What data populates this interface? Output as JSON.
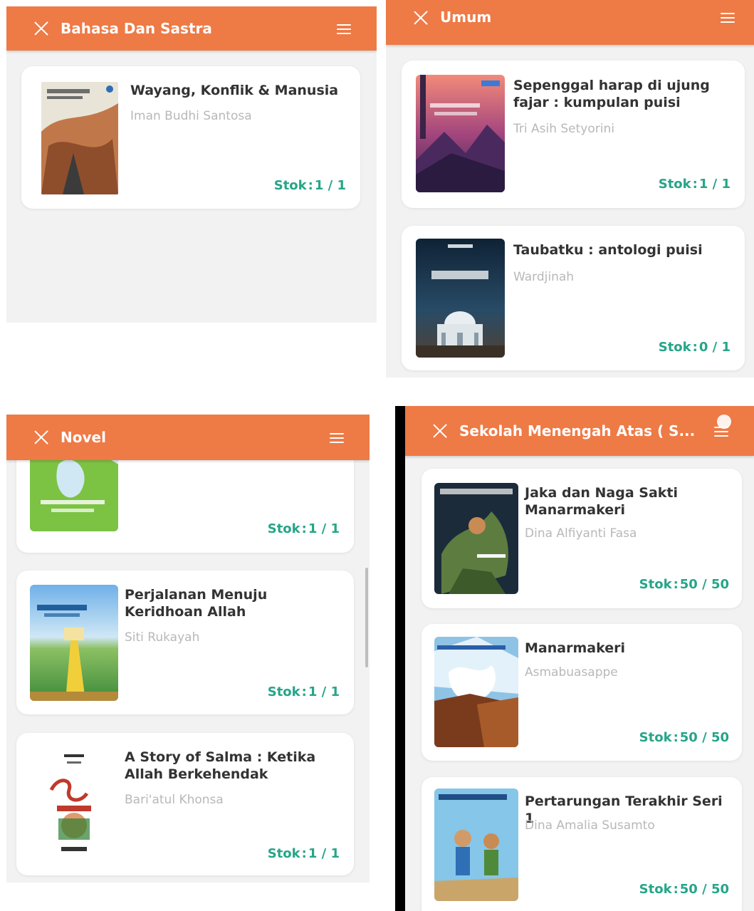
{
  "panels": {
    "bahasa": {
      "title": "Bahasa Dan Sastra",
      "books": [
        {
          "title": "Wayang, Konflik & Manusia",
          "author": "Iman Budhi Santosa",
          "stock_label": "Stok",
          "stock": "1 / 1"
        }
      ]
    },
    "umum": {
      "title": "Umum",
      "books": [
        {
          "title": "Sepenggal harap di ujung fajar : kumpulan puisi",
          "author": "Tri Asih Setyorini",
          "stock_label": "Stok",
          "stock": "1 / 1"
        },
        {
          "title": "Taubatku : antologi puisi",
          "author": "Wardjinah",
          "stock_label": "Stok",
          "stock": "0 / 1"
        }
      ]
    },
    "novel": {
      "title": "Novel",
      "books": [
        {
          "title": "",
          "author": "",
          "stock_label": "Stok",
          "stock": "1 / 1"
        },
        {
          "title": "Perjalanan Menuju Keridhoan Allah",
          "author": "Siti Rukayah",
          "stock_label": "Stok",
          "stock": "1 / 1"
        },
        {
          "title": "A Story of Salma : Ketika Allah Berkehendak",
          "author": "Bari'atul Khonsa",
          "stock_label": "Stok",
          "stock": "1 / 1"
        }
      ]
    },
    "sekolah": {
      "title": "Sekolah Menengah Atas ( S...",
      "books": [
        {
          "title": "Jaka dan Naga Sakti Manarmakeri",
          "author": "Dina Alfiyanti Fasa",
          "stock_label": "Stok",
          "stock": "50 / 50"
        },
        {
          "title": "Manarmakeri",
          "author": "Asmabuasappe",
          "stock_label": "Stok",
          "stock": "50 / 50"
        },
        {
          "title": "Pertarungan Terakhir Seri 1",
          "author": "Dina Amalia Susamto",
          "stock_label": "Stok",
          "stock": "50 / 50"
        }
      ]
    }
  },
  "colors": {
    "appbar": "#ee7a46",
    "stock": "#26a589",
    "background": "#f2f2f2",
    "card": "#ffffff"
  },
  "icons": {
    "close": "close-icon",
    "menu": "menu-icon"
  }
}
